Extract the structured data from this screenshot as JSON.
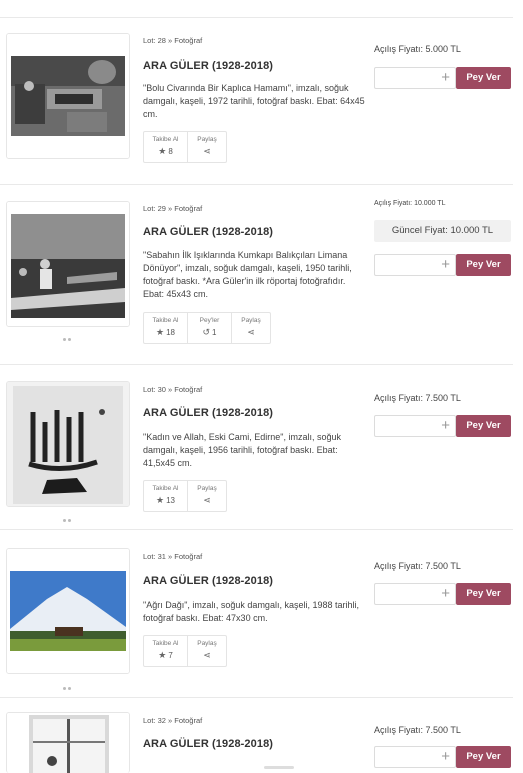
{
  "labels": {
    "follow": "Takibe Al",
    "share": "Paylaş",
    "bids": "Pey'ler",
    "bid_button": "Pey Ver",
    "opening_price_label": "Açılış Fiyatı:",
    "current_price_label": "Güncel Fiyat:"
  },
  "lots": [
    {
      "lot_line": "Lot: 28 » Fotoğraf",
      "artist": "ARA GÜLER (1928-2018)",
      "description": "\"Bolu Civarında Bir Kaplıca Hamamı\", imzalı, soğuk damgalı, kaşeli, 1972 tarihli, fotoğraf baskı. Ebat: 64x45 cm.",
      "follow_count": "8",
      "opening_price": "5.000 TL",
      "image_subject": "bath-photo"
    },
    {
      "lot_line": "Lot: 29 » Fotoğraf",
      "artist": "ARA GÜLER (1928-2018)",
      "description": "\"Sabahın İlk Işıklarında Kumkapı Balıkçıları Limana Dönüyor\", imzalı, soğuk damgalı, kaşeli, 1950 tarihli, fotoğraf baskı. *Ara Güler'in ilk röportaj fotoğrafıdır. Ebat: 45x43 cm.",
      "follow_count": "18",
      "bid_count": "1",
      "opening_price": "10.000 TL",
      "current_price": "10.000 TL",
      "image_subject": "fishermen-photo"
    },
    {
      "lot_line": "Lot: 30 » Fotoğraf",
      "artist": "ARA GÜLER (1928-2018)",
      "description": "\"Kadın ve Allah, Eski Cami, Edirne\", imzalı, soğuk damgalı, kaşeli, 1956 tarihli, fotoğraf baskı. Ebat: 41,5x45 cm.",
      "follow_count": "13",
      "opening_price": "7.500 TL",
      "image_subject": "calligraphy-photo"
    },
    {
      "lot_line": "Lot: 31 » Fotoğraf",
      "artist": "ARA GÜLER (1928-2018)",
      "description": "\"Ağrı Dağı\", imzalı, soğuk damgalı, kaşeli, 1988 tarihli, fotoğraf baskı. Ebat: 47x30 cm.",
      "follow_count": "7",
      "opening_price": "7.500 TL",
      "image_subject": "mountain-photo"
    },
    {
      "lot_line": "Lot: 32 » Fotoğraf",
      "artist": "ARA GÜLER (1928-2018)",
      "opening_price": "7.500 TL",
      "image_subject": "window-photo"
    }
  ],
  "colors": {
    "bid_button": "#9e4a61",
    "current_price_bg": "#f1f1f1"
  },
  "icons": {
    "follow": "star-icon",
    "share": "share-icon",
    "bids": "history-icon",
    "add": "plus-icon"
  }
}
